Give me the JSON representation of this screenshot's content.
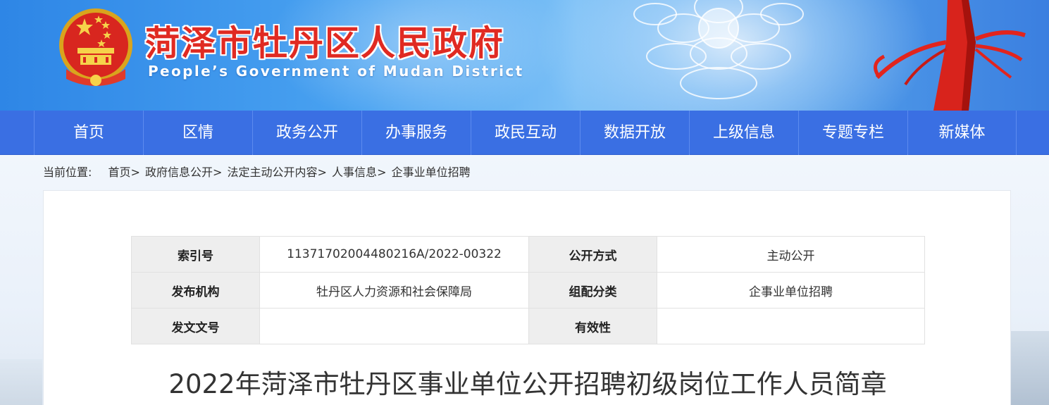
{
  "header": {
    "title": "菏泽市牡丹区人民政府",
    "subtitle": "People’s Government of Mudan District",
    "colors": {
      "title_red": "#e02a22",
      "nav_blue": "#3a6fe3",
      "banner_blue": "#2e86e6"
    }
  },
  "nav": {
    "items": [
      {
        "label": "首页"
      },
      {
        "label": "区情"
      },
      {
        "label": "政务公开"
      },
      {
        "label": "办事服务"
      },
      {
        "label": "政民互动"
      },
      {
        "label": "数据开放"
      },
      {
        "label": "上级信息"
      },
      {
        "label": "专题专栏"
      },
      {
        "label": "新媒体"
      }
    ]
  },
  "breadcrumb": {
    "label": "当前位置:",
    "separator": ">",
    "items": [
      {
        "label": "首页"
      },
      {
        "label": "政府信息公开"
      },
      {
        "label": "法定主动公开内容"
      },
      {
        "label": "人事信息"
      },
      {
        "label": "企事业单位招聘"
      }
    ]
  },
  "meta": {
    "rows": [
      [
        {
          "key": "索引号",
          "value": "11371702004480216A/2022-00322"
        },
        {
          "key": "公开方式",
          "value": "主动公开"
        }
      ],
      [
        {
          "key": "发布机构",
          "value": "牡丹区人力资源和社会保障局"
        },
        {
          "key": "组配分类",
          "value": "企事业单位招聘"
        }
      ],
      [
        {
          "key": "发文文号",
          "value": ""
        },
        {
          "key": "有效性",
          "value": ""
        }
      ]
    ]
  },
  "article": {
    "title": "2022年菏泽市牡丹区事业单位公开招聘初级岗位工作人员简章"
  }
}
